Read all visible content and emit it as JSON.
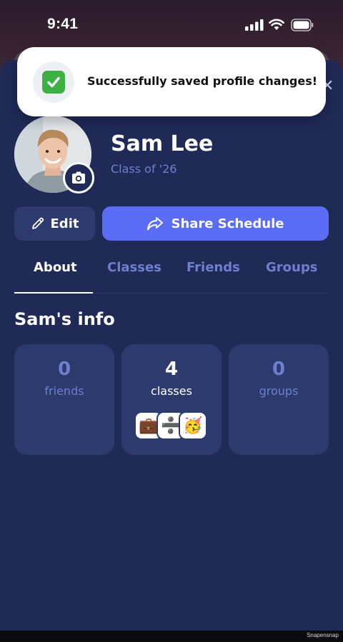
{
  "status_bar": {
    "time": "9:41"
  },
  "toast": {
    "message": "Successfully saved profile changes!",
    "icon": "check-mark-icon"
  },
  "profile": {
    "name": "Sam Lee",
    "class_of": "Class of '26"
  },
  "actions": {
    "edit_label": "Edit",
    "share_label": "Share Schedule"
  },
  "tabs": [
    {
      "label": "About",
      "active": true
    },
    {
      "label": "Classes",
      "active": false
    },
    {
      "label": "Friends",
      "active": false
    },
    {
      "label": "Groups",
      "active": false
    }
  ],
  "info": {
    "title": "Sam's info",
    "stats": [
      {
        "value": "0",
        "label": "friends"
      },
      {
        "value": "4",
        "label": "classes",
        "emojis": [
          "💼",
          "➗",
          "🥳"
        ]
      },
      {
        "value": "0",
        "label": "groups"
      }
    ]
  },
  "watermark": "Snapensnap",
  "colors": {
    "background": "#1f2a57",
    "card": "#2c3a6e",
    "accent": "#5b6cf6",
    "muted_text": "#6f7fcf",
    "success": "#3cb043"
  }
}
